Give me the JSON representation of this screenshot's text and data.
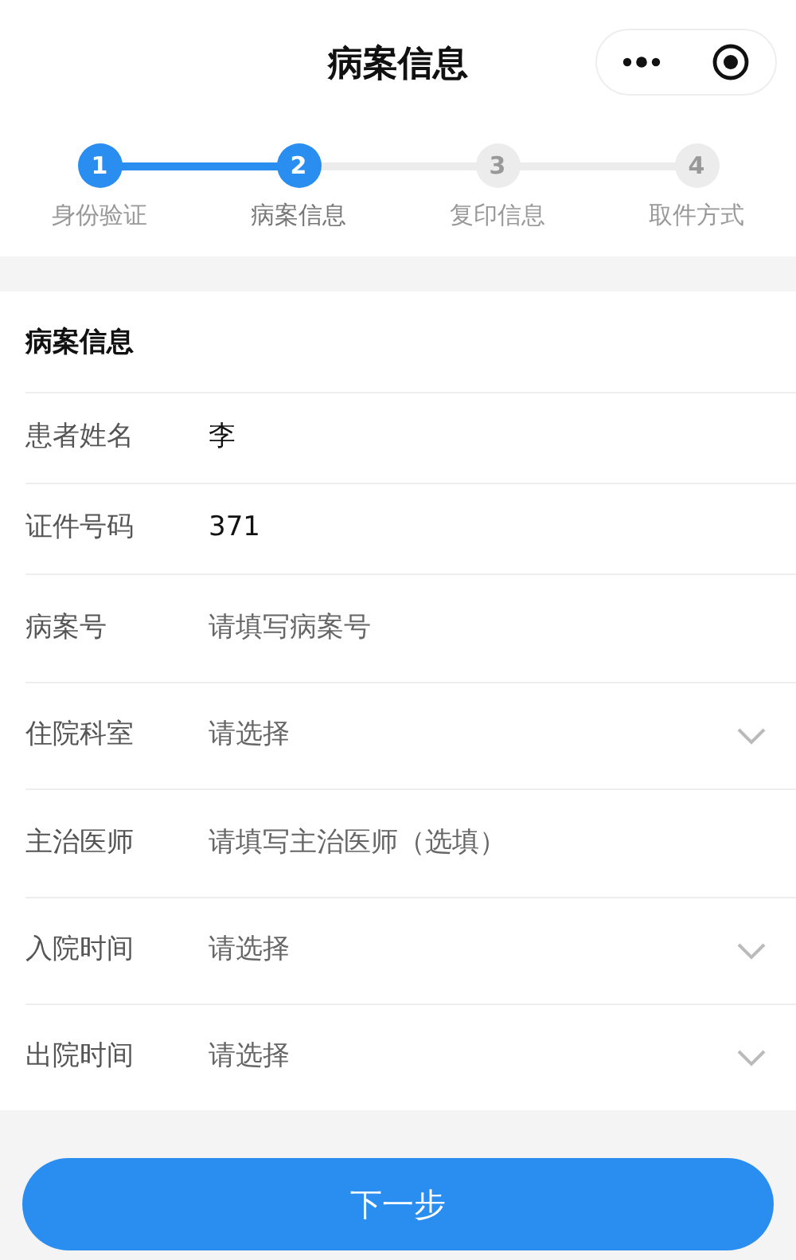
{
  "window": {
    "title": "病案信息"
  },
  "steps": [
    {
      "number": "1",
      "label": "身份验证",
      "reached": true,
      "selected": false
    },
    {
      "number": "2",
      "label": "病案信息",
      "reached": true,
      "selected": true
    },
    {
      "number": "3",
      "label": "复印信息",
      "reached": false,
      "selected": false
    },
    {
      "number": "4",
      "label": "取件方式",
      "reached": false,
      "selected": false
    }
  ],
  "section_title": "病案信息",
  "fields": [
    {
      "label": "患者姓名",
      "kind": "text",
      "value": "李"
    },
    {
      "label": "证件号码",
      "kind": "text",
      "value": "371"
    },
    {
      "label": "病案号",
      "kind": "input",
      "placeholder": "请填写病案号"
    },
    {
      "label": "住院科室",
      "kind": "select",
      "placeholder": "请选择"
    },
    {
      "label": "主治医师",
      "kind": "input",
      "placeholder": "请填写主治医师（选填）"
    },
    {
      "label": "入院时间",
      "kind": "select",
      "placeholder": "请选择"
    },
    {
      "label": "出院时间",
      "kind": "select",
      "placeholder": "请选择"
    }
  ],
  "next_button": "下一步"
}
